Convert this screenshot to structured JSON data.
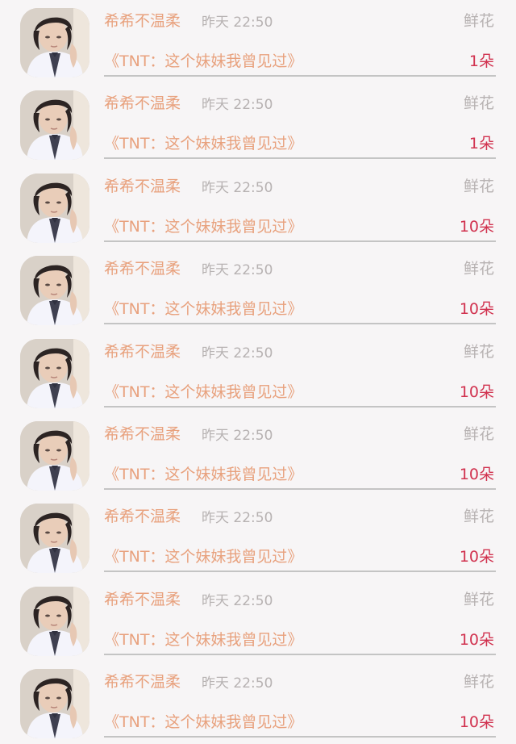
{
  "gift_list": [
    {
      "username": "希希不温柔",
      "time": "昨天 22:50",
      "gift_type": "鲜花",
      "book_title": "《TNT：这个妹妹我曾见过》",
      "count": "1朵"
    },
    {
      "username": "希希不温柔",
      "time": "昨天 22:50",
      "gift_type": "鲜花",
      "book_title": "《TNT：这个妹妹我曾见过》",
      "count": "1朵"
    },
    {
      "username": "希希不温柔",
      "time": "昨天 22:50",
      "gift_type": "鲜花",
      "book_title": "《TNT：这个妹妹我曾见过》",
      "count": "10朵"
    },
    {
      "username": "希希不温柔",
      "time": "昨天 22:50",
      "gift_type": "鲜花",
      "book_title": "《TNT：这个妹妹我曾见过》",
      "count": "10朵"
    },
    {
      "username": "希希不温柔",
      "time": "昨天 22:50",
      "gift_type": "鲜花",
      "book_title": "《TNT：这个妹妹我曾见过》",
      "count": "10朵"
    },
    {
      "username": "希希不温柔",
      "time": "昨天 22:50",
      "gift_type": "鲜花",
      "book_title": "《TNT：这个妹妹我曾见过》",
      "count": "10朵"
    },
    {
      "username": "希希不温柔",
      "time": "昨天 22:50",
      "gift_type": "鲜花",
      "book_title": "《TNT：这个妹妹我曾见过》",
      "count": "10朵"
    },
    {
      "username": "希希不温柔",
      "time": "昨天 22:50",
      "gift_type": "鲜花",
      "book_title": "《TNT：这个妹妹我曾见过》",
      "count": "10朵"
    },
    {
      "username": "希希不温柔",
      "time": "昨天 22:50",
      "gift_type": "鲜花",
      "book_title": "《TNT：这个妹妹我曾见过》",
      "count": "10朵"
    }
  ],
  "colors": {
    "accent": "#e8a17d",
    "count": "#d1324f",
    "muted": "#b7b2b2",
    "background": "#f7f5f6"
  },
  "icons": {
    "avatar": "user-avatar-photo"
  }
}
